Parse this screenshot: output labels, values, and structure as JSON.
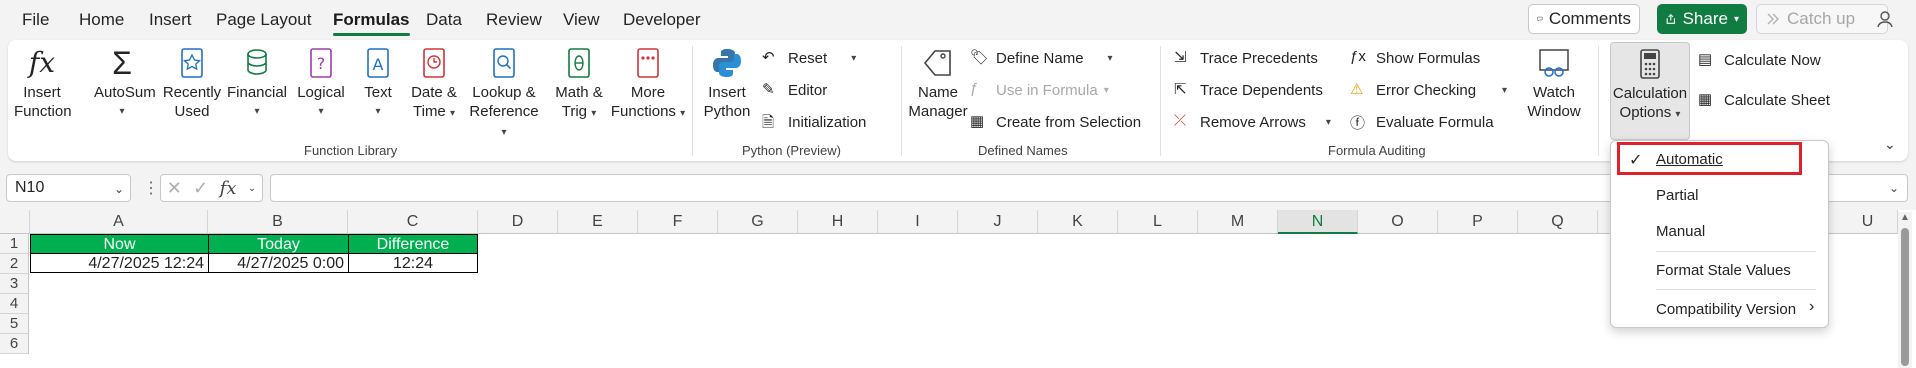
{
  "menu": {
    "tabs": [
      "File",
      "Home",
      "Insert",
      "Page Layout",
      "Formulas",
      "Data",
      "Review",
      "View",
      "Developer"
    ],
    "active_tab": "Formulas",
    "comments_label": "Comments",
    "share_label": "Share",
    "catchup_label": "Catch up"
  },
  "ribbon": {
    "function_library": {
      "label": "Function Library",
      "insert_function": "Insert Function",
      "autosum": "AutoSum",
      "recently_used": "Recently Used",
      "financial": "Financial",
      "logical": "Logical",
      "text": "Text",
      "date_time": "Date & Time",
      "lookup_reference": "Lookup & Reference",
      "math_trig": "Math & Trig",
      "more_functions": "More Functions"
    },
    "python": {
      "label": "Python (Preview)",
      "insert_python": "Insert Python",
      "reset": "Reset",
      "editor": "Editor",
      "initialization": "Initialization"
    },
    "defined_names": {
      "label": "Defined Names",
      "name_manager": "Name Manager",
      "define_name": "Define Name",
      "use_in_formula": "Use in Formula",
      "create_from_selection": "Create from Selection"
    },
    "formula_auditing": {
      "label": "Formula Auditing",
      "trace_precedents": "Trace Precedents",
      "trace_dependents": "Trace Dependents",
      "remove_arrows": "Remove Arrows",
      "show_formulas": "Show Formulas",
      "error_checking": "Error Checking",
      "evaluate_formula": "Evaluate Formula",
      "watch_window": "Watch Window"
    },
    "calculation": {
      "calculation_options": "Calculation Options",
      "calculate_now": "Calculate Now",
      "calculate_sheet": "Calculate Sheet"
    }
  },
  "formula_bar": {
    "name_box": "N10",
    "fx": "fx",
    "formula": ""
  },
  "sheet": {
    "columns": [
      "A",
      "B",
      "C",
      "D",
      "E",
      "F",
      "G",
      "H",
      "I",
      "J",
      "K",
      "L",
      "M",
      "N",
      "O",
      "P",
      "Q",
      "U"
    ],
    "selected_column": "N",
    "rows": [
      "1",
      "2",
      "3",
      "4",
      "5",
      "6"
    ],
    "headers": [
      "Now",
      "Today",
      "Difference"
    ],
    "values": [
      "4/27/2025 12:24",
      "4/27/2025 0:00",
      "12:24"
    ]
  },
  "dropdown": {
    "items": [
      "Automatic",
      "Partial",
      "Manual",
      "Format Stale Values",
      "Compatibility Version"
    ],
    "checked": "Automatic"
  },
  "colors": {
    "accent": "#107c41",
    "header_fill": "#00b050",
    "highlight": "#e0202a"
  }
}
